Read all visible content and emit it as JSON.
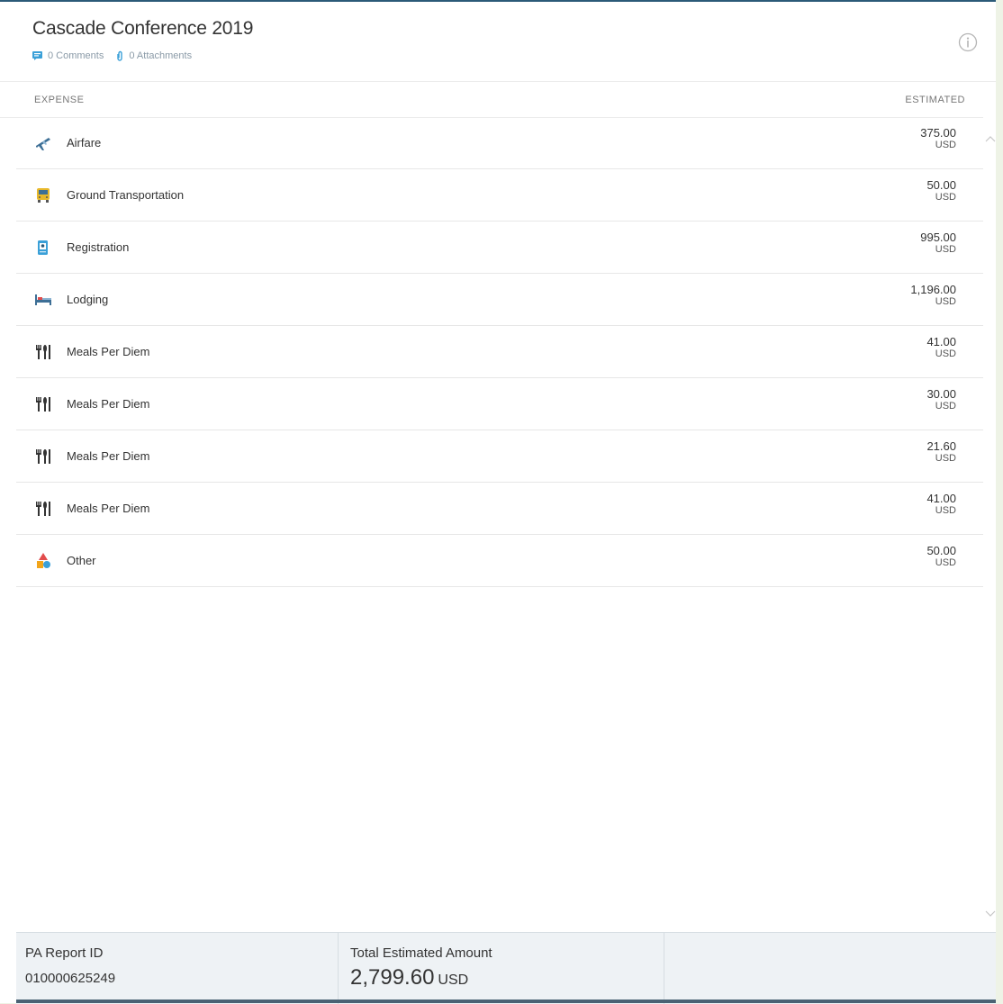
{
  "header": {
    "title": "Cascade Conference 2019",
    "comments_label": "0 Comments",
    "attachments_label": "0 Attachments"
  },
  "table": {
    "col_expense": "EXPENSE",
    "col_estimated": "ESTIMATED",
    "rows": [
      {
        "icon": "airplane-icon",
        "name": "Airfare",
        "amount": "375.00",
        "currency": "USD"
      },
      {
        "icon": "bus-icon",
        "name": "Ground Transportation",
        "amount": "50.00",
        "currency": "USD"
      },
      {
        "icon": "registration-icon",
        "name": "Registration",
        "amount": "995.00",
        "currency": "USD"
      },
      {
        "icon": "bed-icon",
        "name": "Lodging",
        "amount": "1,196.00",
        "currency": "USD"
      },
      {
        "icon": "utensils-icon",
        "name": "Meals Per Diem",
        "amount": "41.00",
        "currency": "USD"
      },
      {
        "icon": "utensils-icon",
        "name": "Meals Per Diem",
        "amount": "30.00",
        "currency": "USD"
      },
      {
        "icon": "utensils-icon",
        "name": "Meals Per Diem",
        "amount": "21.60",
        "currency": "USD"
      },
      {
        "icon": "utensils-icon",
        "name": "Meals Per Diem",
        "amount": "41.00",
        "currency": "USD"
      },
      {
        "icon": "shapes-icon",
        "name": "Other",
        "amount": "50.00",
        "currency": "USD"
      }
    ]
  },
  "footer": {
    "report_id_label": "PA Report ID",
    "report_id": "010000625249",
    "total_label": "Total Estimated Amount",
    "total_value": "2,799.60",
    "total_currency": "USD"
  },
  "colors": {
    "accent": "#2b5a78",
    "footer_bg": "#eef2f5",
    "page_bg": "#eef3e6"
  }
}
